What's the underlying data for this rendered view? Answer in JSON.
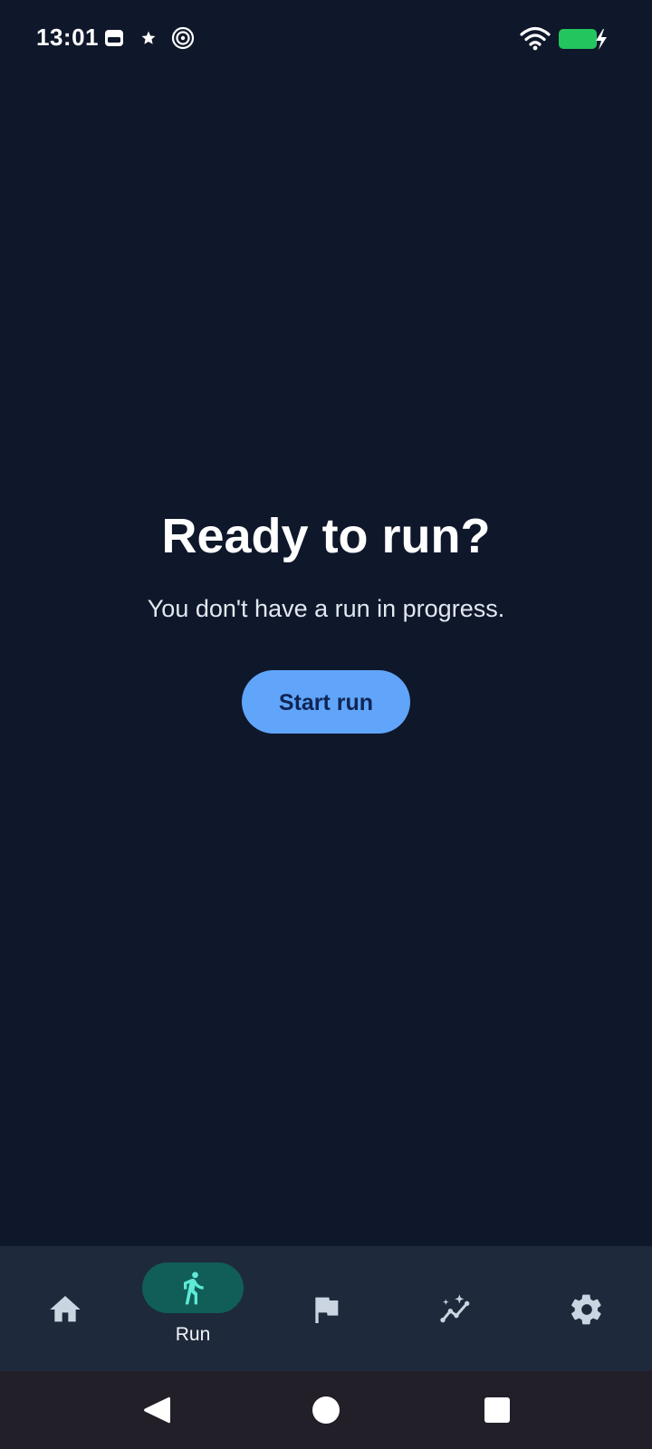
{
  "status_bar": {
    "time": "13:01",
    "icons_left": [
      "sim-card-icon",
      "star-icon",
      "spiral-icon"
    ],
    "icons_right": [
      "wifi-icon",
      "battery-charging-icon"
    ],
    "battery_color": "#22c55e"
  },
  "main": {
    "title": "Ready to run?",
    "subtitle": "You don't have a run in progress.",
    "start_button_label": "Start run"
  },
  "bottom_nav": {
    "items": [
      {
        "icon": "home-icon",
        "label": "",
        "active": false
      },
      {
        "icon": "run-icon",
        "label": "Run",
        "active": true
      },
      {
        "icon": "flag-icon",
        "label": "",
        "active": false
      },
      {
        "icon": "chart-sparkle-icon",
        "label": "",
        "active": false
      },
      {
        "icon": "gear-icon",
        "label": "",
        "active": false
      }
    ]
  },
  "system_nav": {
    "buttons": [
      "back-icon",
      "home-circle-icon",
      "recents-icon"
    ]
  },
  "colors": {
    "background": "#0f172a",
    "nav_background": "#1e293b",
    "accent_button": "#60a5fa",
    "active_pill": "#115e59",
    "active_icon": "#5eead4",
    "inactive_icon": "#cbd5e1"
  }
}
